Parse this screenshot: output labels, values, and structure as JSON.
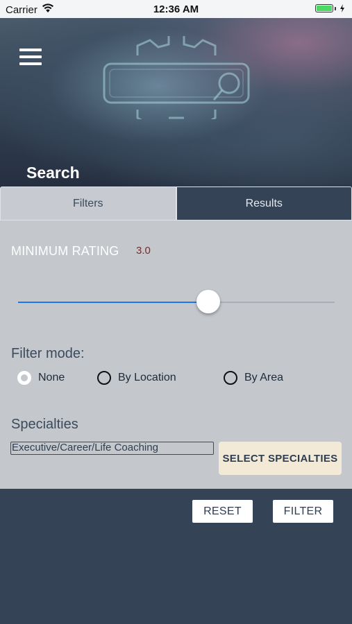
{
  "status_bar": {
    "carrier": "Carrier",
    "time": "12:36 AM",
    "wifi_icon": "wifi-icon",
    "battery_icon": "battery-icon"
  },
  "header": {
    "title": "Search",
    "menu_icon": "hamburger-menu-icon",
    "logo_icon": "gear-search-logo-icon"
  },
  "tabs": [
    {
      "label": "Filters",
      "active": true
    },
    {
      "label": "Results",
      "active": false
    }
  ],
  "filters": {
    "minimum_rating_label": "MINIMUM RATING",
    "minimum_rating_value": "3.0",
    "slider_fraction": 0.6,
    "filter_mode_label": "Filter mode:",
    "filter_mode_options": [
      {
        "label": "None",
        "selected": true
      },
      {
        "label": "By Location",
        "selected": false
      },
      {
        "label": "By Area",
        "selected": false
      }
    ],
    "specialties_label": "Specialties",
    "specialties_value": "Executive/Career/Life Coaching",
    "select_specialties_label": "SELECT SPECIALTIES"
  },
  "actions": {
    "reset_label": "RESET",
    "filter_label": "FILTER"
  },
  "colors": {
    "accent_blue": "#1a78e5",
    "dark_navy": "#344456",
    "panel_gray": "#c4c8cd",
    "rating_value": "#7a2a2a",
    "select_button_bg": "#f2ead6"
  }
}
